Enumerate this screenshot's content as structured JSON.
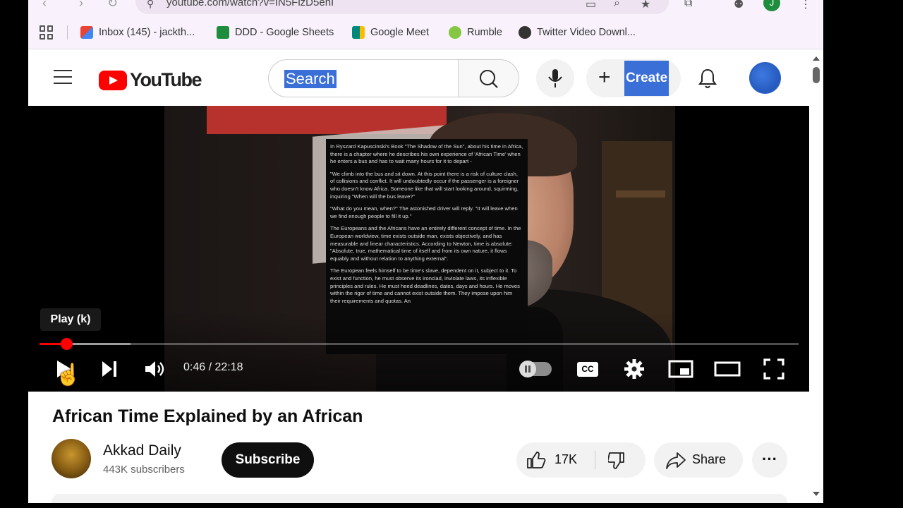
{
  "browser": {
    "url": "youtube.com/watch?v=IN5FlzD5enI",
    "profile_initial": "J",
    "bookmarks": [
      {
        "label": "Inbox (145) - jackth...",
        "icon": "gmail-icon",
        "color": "#d93025"
      },
      {
        "label": "DDD - Google Sheets",
        "icon": "sheets-icon",
        "color": "#1e8e3e"
      },
      {
        "label": "Google Meet",
        "icon": "meet-icon",
        "color": "#00897b"
      },
      {
        "label": "Rumble",
        "icon": "rumble-icon",
        "color": "#85c742"
      },
      {
        "label": "Twitter Video Downl...",
        "icon": "globe-icon",
        "color": "#333333"
      }
    ]
  },
  "header": {
    "logo_text": "YouTube",
    "search_text": "Search",
    "create_label": "Create"
  },
  "player": {
    "tooltip": "Play (k)",
    "time": "0:46 / 22:18",
    "progress_played": 0.035,
    "progress_buffered": 0.12,
    "overlay_paragraphs": [
      "In Ryszard Kapuscinski's Book \"The Shadow of the Sun\", about his time in Africa, there is a chapter where he describes his own experience of 'African Time' when he enters a bus and has to wait many hours for it to depart -",
      "\"We climb into the bus and sit down. At this point there is a risk of culture clash, of collisions and conflict. It will undoubtedly occur if the passenger is a foreigner who doesn't know Africa. Someone like that will start looking around, squirming, inquiring \"When will the bus leave?\"",
      "\"What do you mean, when?\" The astonished driver will reply. \"It will leave when we find enough people to fill it up.\"",
      "The Europeans and the Africans have an entirely different concept of time. In the European worldview, time exists outside man, exists objectively, and has measurable and linear characteristics. According to Newton, time is absolute: \"Absolute, true, mathematical time of itself and from its own nature, it flows equably and without relation to anything external\".",
      "The European feels himself to be time's slave, dependent on it, subject to it. To exist and function, he must observe its ironclad, inviolate laws, its inflexible principles and rules. He must heed deadlines, dates, days and hours. He moves within the rigor of time and cannot exist outside them. They impose upon him their requirements and quotas. An"
    ]
  },
  "video": {
    "title": "African Time Explained by an African",
    "channel_name": "Akkad Daily",
    "subscribers": "443K subscribers",
    "subscribe_label": "Subscribe",
    "likes": "17K",
    "share_label": "Share",
    "more_label": "···"
  }
}
